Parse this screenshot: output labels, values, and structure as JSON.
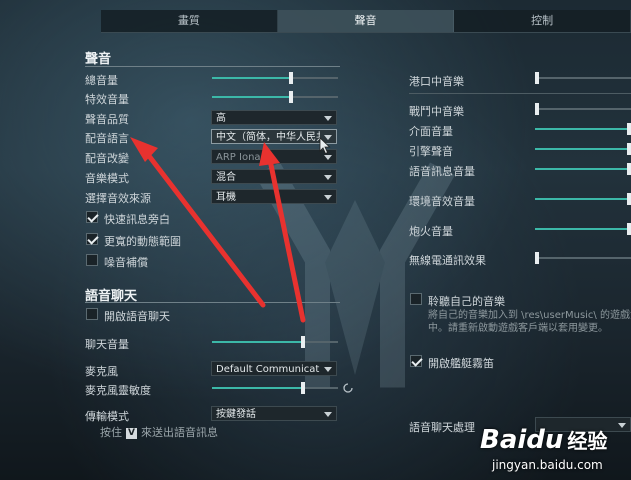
{
  "tabs": [
    {
      "label": "畫質",
      "active": false
    },
    {
      "label": "聲音",
      "active": true
    },
    {
      "label": "控制",
      "active": false
    }
  ],
  "sound_section": {
    "title": "聲音",
    "master_volume": {
      "label": "總音量",
      "value": 0.63
    },
    "effects_volume": {
      "label": "特效音量",
      "value": 0.63
    },
    "sound_quality": {
      "label": "聲音品質",
      "value": "高"
    },
    "voice_language": {
      "label": "配音語言",
      "value": "中文（简体，中华人民共和国"
    },
    "voice_mod": {
      "label": "配音改變",
      "value": "ARP Iona"
    },
    "music_mode": {
      "label": "音樂模式",
      "value": "混合"
    },
    "output_device": {
      "label": "選擇音效來源",
      "value": "耳機"
    },
    "checkboxes": [
      {
        "label": "快速訊息旁白",
        "checked": true
      },
      {
        "label": "更寬的動態範圍",
        "checked": true
      },
      {
        "label": "噪音補償",
        "checked": false
      }
    ]
  },
  "voice_section": {
    "title": "語音聊天",
    "enable_voice": {
      "label": "開啟語音聊天",
      "checked": false
    },
    "chat_volume": {
      "label": "聊天音量",
      "value": 0.72
    },
    "microphone": {
      "label": "麥克風",
      "value": "Default Communication Device"
    },
    "mic_sensitivity": {
      "label": "麥克風靈敏度",
      "value": 0.72
    },
    "transmit_mode": {
      "label": "傳輸模式",
      "value": "按鍵發話"
    },
    "ptt_hint": {
      "prefix": "按住",
      "key": "V",
      "suffix": "來送出語音訊息"
    }
  },
  "right_column": {
    "port_music": {
      "label": "港口中音樂",
      "value": 0.0
    },
    "battle_music": {
      "label": "戰鬥中音樂",
      "value": 0.0
    },
    "ui_volume": {
      "label": "介面音量",
      "value": 1.0
    },
    "engine_volume": {
      "label": "引擎聲音",
      "value": 1.0
    },
    "voice_msg_volume": {
      "label": "語音訊息音量",
      "value": 1.0
    },
    "ambient_volume": {
      "label": "環境音效音量",
      "value": 1.0
    },
    "gun_volume": {
      "label": "炮火音量",
      "value": 1.0
    },
    "radio_effect": {
      "label": "無線電通訊效果",
      "value": 0.0
    },
    "own_music": {
      "label": "聆聽自己的音樂",
      "checked": false,
      "note_line1": "將自己的音樂加入到 \\res\\userMusic\\ 的遊戲資",
      "note_line2": "中。請重新啟動遊戲客戶端以套用變更。"
    },
    "ship_horn": {
      "label": "開啟艦艇霧笛",
      "checked": true
    },
    "voice_processing": {
      "label": "語音聊天處理"
    }
  },
  "watermark": {
    "brand": "Baidu",
    "brand_cn": "经验",
    "url": "jingyan.baidu.com"
  },
  "colors": {
    "accent": "#3cb8a8",
    "arrow": "#e8322f"
  }
}
